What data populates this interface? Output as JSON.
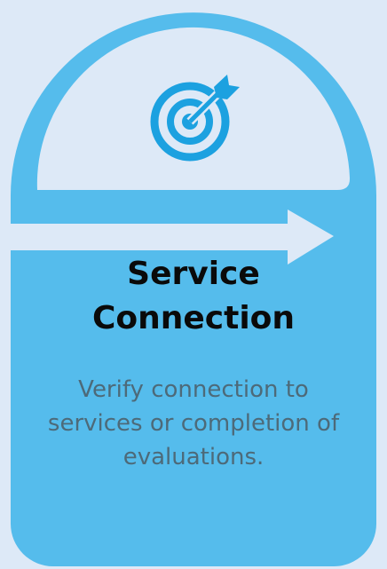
{
  "card": {
    "title_line1": "Service",
    "title_line2": "Connection",
    "description": "Verify connection to services or completion of evaluations.",
    "icon": "target-icon"
  },
  "colors": {
    "background": "#dde9f7",
    "card": "#55bcec",
    "inner_panel": "#dde9f7",
    "icon": "#1ca1e0",
    "arrow": "#dde9f7",
    "title_text": "#0a0a0a",
    "description_text": "#4d6a79"
  }
}
